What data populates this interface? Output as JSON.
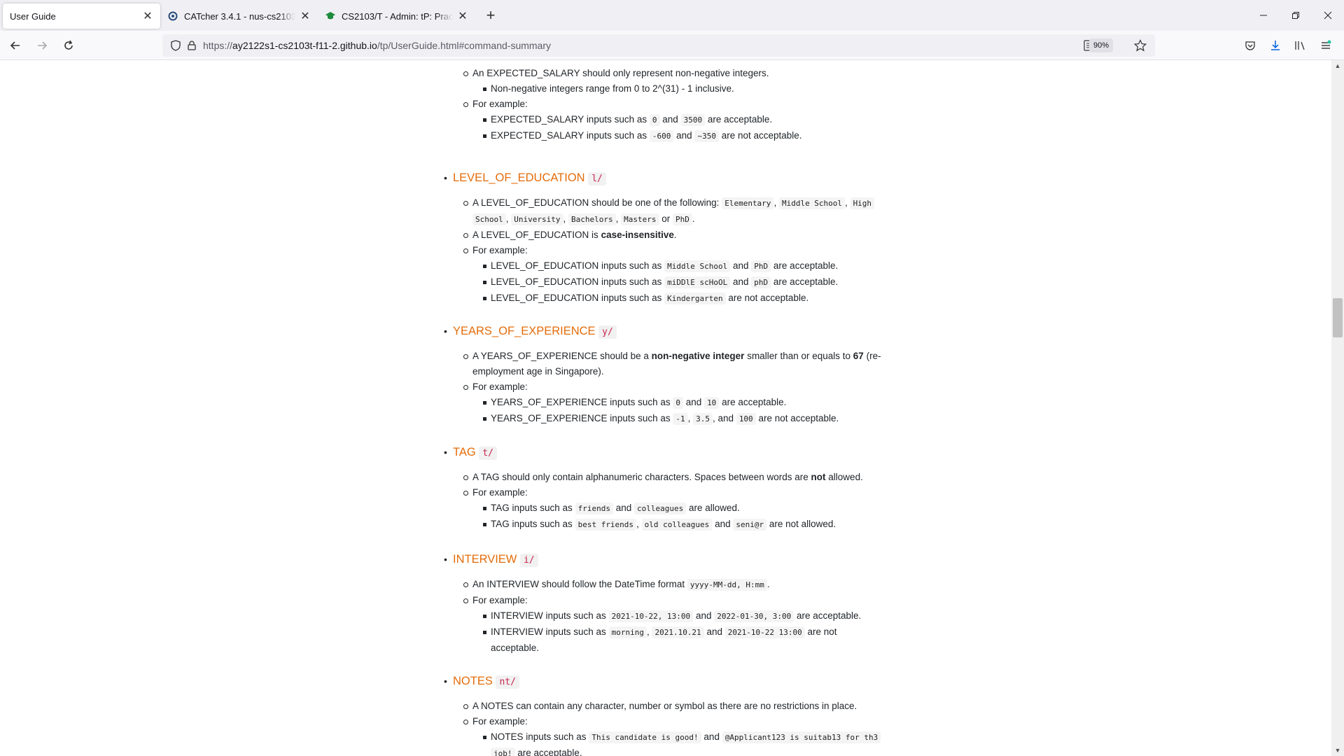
{
  "tabs": [
    {
      "title": "User Guide",
      "active": true
    },
    {
      "title": "CATcher 3.4.1 - nus-cs2103-AY2",
      "active": false
    },
    {
      "title": "CS2103/T - Admin: tP: Practical",
      "active": false
    }
  ],
  "nav": {
    "url_prefix": "https://",
    "url_host": "ay2122s1-cs2103t-f11-2.github.io",
    "url_path": "/tp/UserGuide.html#command-summary",
    "zoom": "90%"
  },
  "doc": {
    "salary": {
      "line1": "An EXPECTED_SALARY should only represent non-negative integers.",
      "line2": "Non-negative integers range from 0 to 2^(31) - 1 inclusive.",
      "for_example": "For example:",
      "ex1_pre": "EXPECTED_SALARY inputs such as",
      "ex1_c1": "0",
      "ex1_and": "and",
      "ex1_c2": "3500",
      "ex1_post": "are acceptable.",
      "ex2_pre": "EXPECTED_SALARY inputs such as",
      "ex2_c1": "-600",
      "ex2_and": "and",
      "ex2_c2": "~350",
      "ex2_post": "are not acceptable."
    },
    "education": {
      "title": "LEVEL_OF_EDUCATION",
      "prefix": "l/",
      "line1_pre": "A LEVEL_OF_EDUCATION should be one of the following:",
      "opt1": "Elementary",
      "opt2": "Middle School",
      "opt3a": "High",
      "opt3b": "School",
      "opt4": "University",
      "opt5": "Bachelors",
      "opt6": "Masters",
      "or": "or",
      "opt7": "PhD",
      "line2_pre": "A LEVEL_OF_EDUCATION is",
      "line2_bold": "case-insensitive",
      "for_example": "For example:",
      "ex1_pre": "LEVEL_OF_EDUCATION inputs such as",
      "ex1_c1": "Middle School",
      "ex1_c2": "PhD",
      "ex1_post": "are acceptable.",
      "ex2_pre": "LEVEL_OF_EDUCATION inputs such as",
      "ex2_c1": "miDDlE scHoOL",
      "ex2_c2": "phD",
      "ex2_post": "are acceptable.",
      "ex3_pre": "LEVEL_OF_EDUCATION inputs such as",
      "ex3_c1": "Kindergarten",
      "ex3_post": "are not acceptable.",
      "and": "and"
    },
    "experience": {
      "title": "YEARS_OF_EXPERIENCE",
      "prefix": "y/",
      "line1_pre": "A YEARS_OF_EXPERIENCE should be a",
      "line1_bold": "non-negative integer",
      "line1_mid": "smaller than or equals to",
      "line1_num": "67",
      "line1_post": "(re-",
      "line1_cont": "employment age in Singapore).",
      "for_example": "For example:",
      "ex1_pre": "YEARS_OF_EXPERIENCE inputs such as",
      "ex1_c1": "0",
      "ex1_c2": "10",
      "ex1_post": "are acceptable.",
      "ex2_pre": "YEARS_OF_EXPERIENCE inputs such as",
      "ex2_c1": "-1",
      "ex2_c2": "3.5",
      "ex2_c3": "100",
      "ex2_mid": ", and",
      "ex2_post": "are not acceptable.",
      "and": "and"
    },
    "tag": {
      "title": "TAG",
      "prefix": "t/",
      "line1_pre": "A TAG should only contain alphanumeric characters. Spaces between words are",
      "line1_bold": "not",
      "line1_post": "allowed.",
      "for_example": "For example:",
      "ex1_pre": "TAG inputs such as",
      "ex1_c1": "friends",
      "ex1_c2": "colleagues",
      "ex1_post": "are allowed.",
      "ex2_pre": "TAG inputs such as",
      "ex2_c1": "best friends",
      "ex2_c2": "old colleagues",
      "ex2_c3": "seni@r",
      "ex2_post": "are not allowed.",
      "and": "and"
    },
    "interview": {
      "title": "INTERVIEW",
      "prefix": "i/",
      "line1_pre": "An INTERVIEW should follow the DateTime format",
      "line1_code": "yyyy-MM-dd, H:mm",
      "for_example": "For example:",
      "ex1_pre": "INTERVIEW inputs such as",
      "ex1_c1": "2021-10-22, 13:00",
      "ex1_c2": "2022-01-30, 3:00",
      "ex1_post": "are acceptable.",
      "ex2_pre": "INTERVIEW inputs such as",
      "ex2_c1": "morning",
      "ex2_c2": "2021.10.21",
      "ex2_c3": "2021-10-22 13:00",
      "ex2_post": "are not",
      "ex2_cont": "acceptable.",
      "and": "and"
    },
    "notes": {
      "title": "NOTES",
      "prefix": "nt/",
      "line1": "A NOTES can contain any character, number or symbol as there are no restrictions in place.",
      "for_example": "For example:",
      "ex1_pre": "NOTES inputs such as",
      "ex1_c1": "This candidate is good!",
      "ex1_c2": "@Applicant123 is suitab13 for th3",
      "ex1_c2b": "job!",
      "ex1_post": "are acceptable.",
      "and": "and"
    }
  }
}
